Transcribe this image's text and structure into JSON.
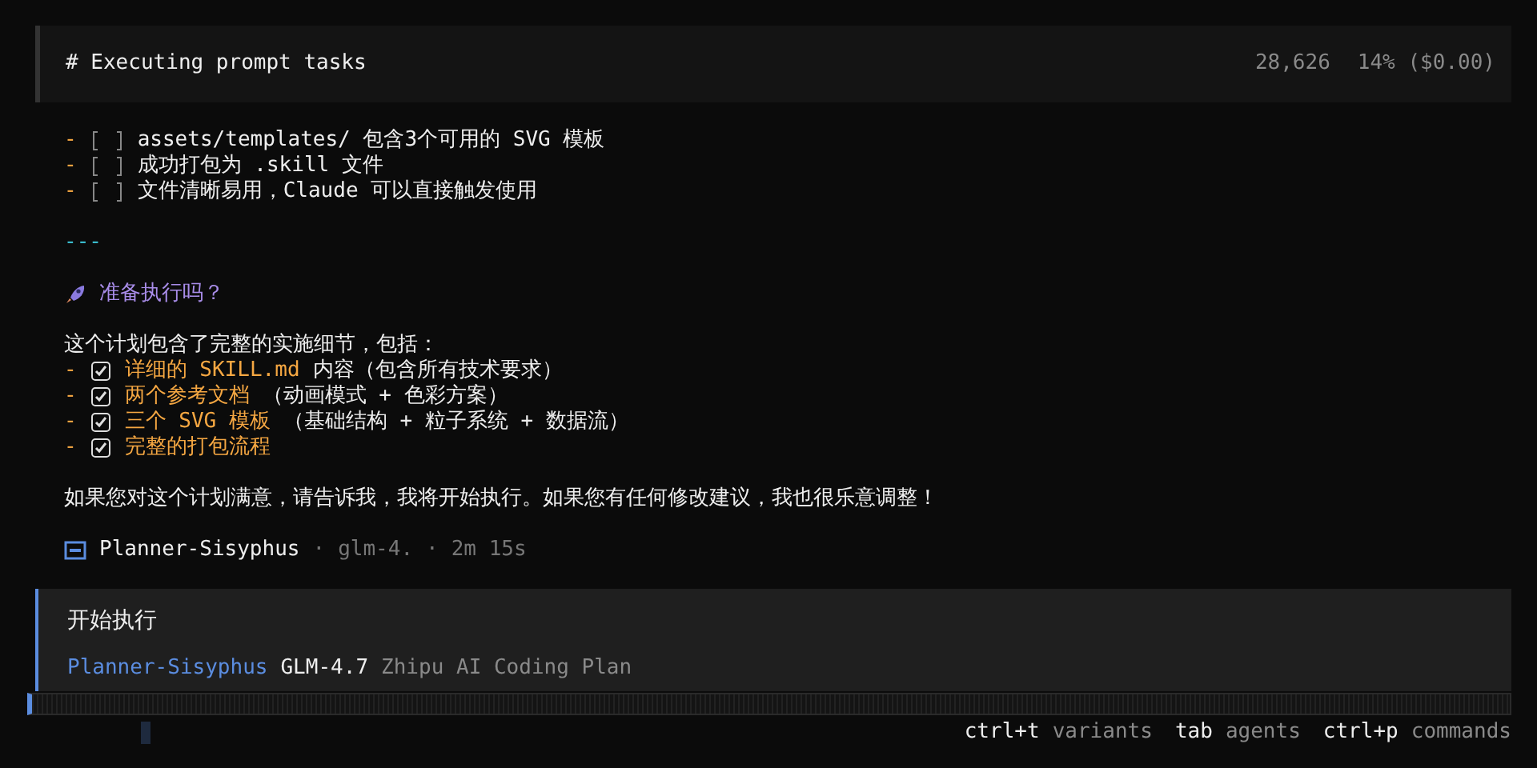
{
  "header": {
    "title": "# Executing prompt tasks",
    "tokens": "28,626",
    "usage": "14% ($0.00)"
  },
  "tasks": [
    {
      "dash": "-",
      "text": "assets/templates/ 包含3个可用的 SVG 模板",
      "checked": false
    },
    {
      "dash": "-",
      "text": "成功打包为 .skill 文件",
      "checked": false
    },
    {
      "dash": "-",
      "text": "文件清晰易用，Claude 可以直接触发使用",
      "checked": false
    }
  ],
  "rule": "---",
  "question": "准备执行吗？",
  "intro": "这个计划包含了完整的实施细节，包括：",
  "plan_items": [
    {
      "dash": "-",
      "highlight": "详细的 SKILL.md",
      "rest": "内容（包含所有技术要求）",
      "checked": true
    },
    {
      "dash": "-",
      "highlight": "两个参考文档",
      "rest": "（动画模式 + 色彩方案）",
      "checked": true
    },
    {
      "dash": "-",
      "highlight": "三个 SVG 模板",
      "rest": "（基础结构 + 粒子系统 + 数据流）",
      "checked": true
    },
    {
      "dash": "-",
      "highlight": "完整的打包流程",
      "checked": true
    }
  ],
  "closing": "如果您对这个计划满意，请告诉我，我将开始执行。如果您有任何修改建议，我也很乐意调整！",
  "meta": {
    "agent": "Planner-Sisyphus",
    "sep1": "·",
    "model": "glm-4.",
    "sep2": "·",
    "duration": "2m 15s"
  },
  "input": {
    "value": "开始执行",
    "agent": "Planner-Sisyphus",
    "model": "GLM-4.7",
    "provider": "Zhipu AI Coding Plan"
  },
  "hints": [
    {
      "key": "ctrl+t",
      "label": "variants"
    },
    {
      "key": "tab",
      "label": "agents"
    },
    {
      "key": "ctrl+p",
      "label": "commands"
    }
  ]
}
